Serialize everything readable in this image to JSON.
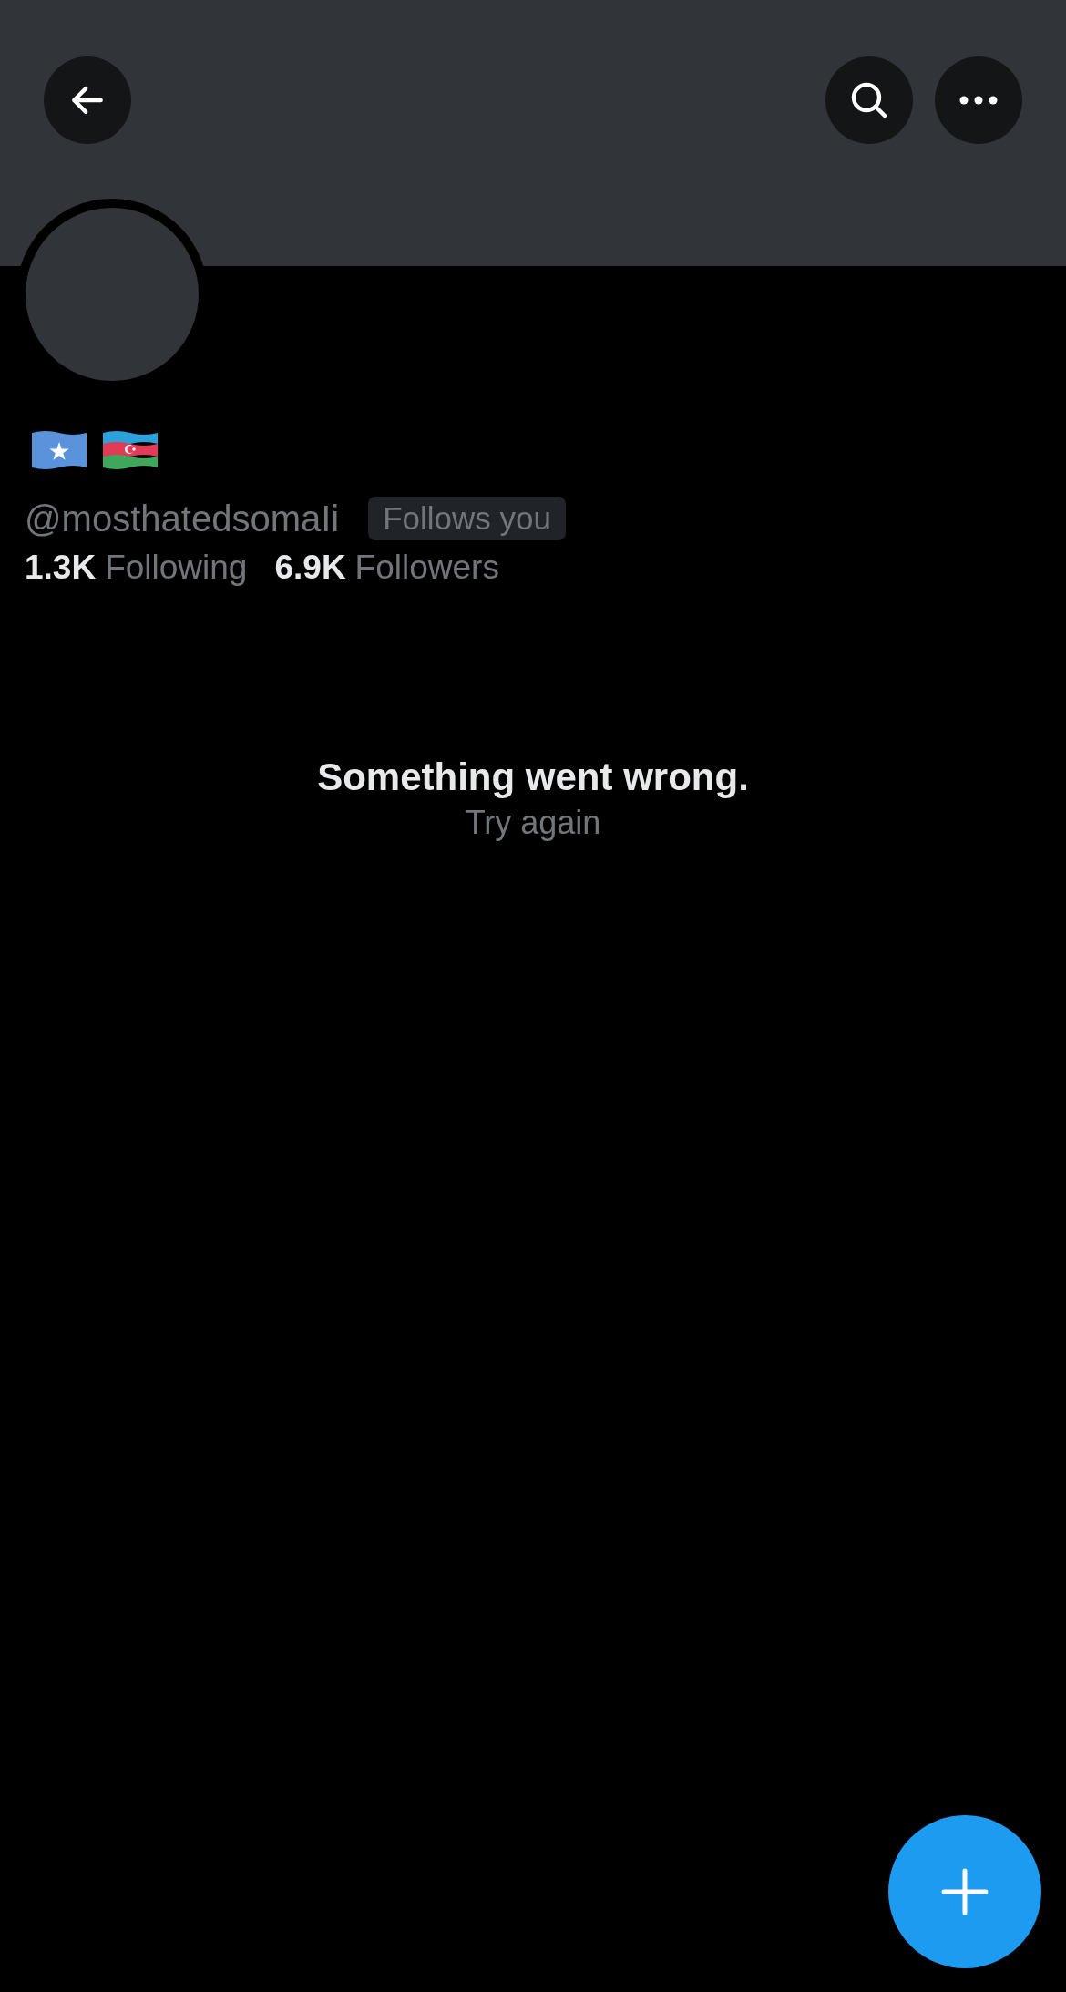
{
  "profile": {
    "handle": "@mosthatedsomaIi",
    "badge": "Follows you"
  },
  "stats": [
    {
      "count": "1.3K",
      "label": "Following"
    },
    {
      "count": "6.9K",
      "label": "Followers"
    }
  ],
  "error": {
    "title": "Something went wrong.",
    "action": "Try again"
  }
}
